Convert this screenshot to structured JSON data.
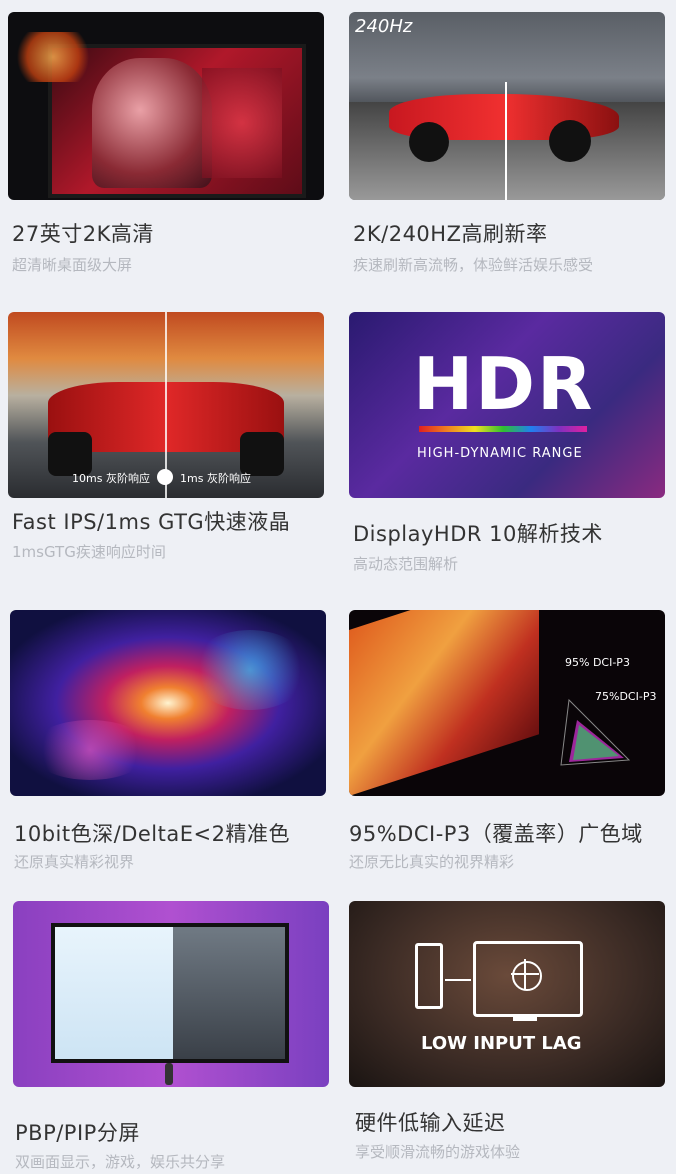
{
  "features": [
    {
      "title": "27英寸2K高清",
      "subtitle": "超清晰桌面级大屏"
    },
    {
      "title": "2K/240HZ高刷新率",
      "subtitle": "疾速刷新高流畅，体验鲜活娱乐感受",
      "badge": "240Hz"
    },
    {
      "title": "Fast IPS/1ms GTG快速液晶",
      "subtitle": "1msGTG疾速响应时间",
      "left_label": "10ms 灰阶响应",
      "right_label": "1ms 灰阶响应"
    },
    {
      "title": "DisplayHDR 10解析技术",
      "subtitle": "高动态范围解析",
      "logo": "HDR",
      "tagline": "HIGH-DYNAMIC RANGE"
    },
    {
      "title": "10bit色深/DeltaE<2精准色",
      "subtitle": "还原真实精彩视界"
    },
    {
      "title": "95%DCI-P3（覆盖率）广色域",
      "subtitle": "还原无比真实的视界精彩",
      "label_a": "95% DCI-P3",
      "label_b": "75%DCI-P3"
    },
    {
      "title": "PBP/PIP分屏",
      "subtitle": "双画面显示，游戏，娱乐共分享"
    },
    {
      "title": "硬件低输入延迟",
      "subtitle": "享受顺滑流畅的游戏体验",
      "caption": "LOW INPUT LAG"
    }
  ]
}
